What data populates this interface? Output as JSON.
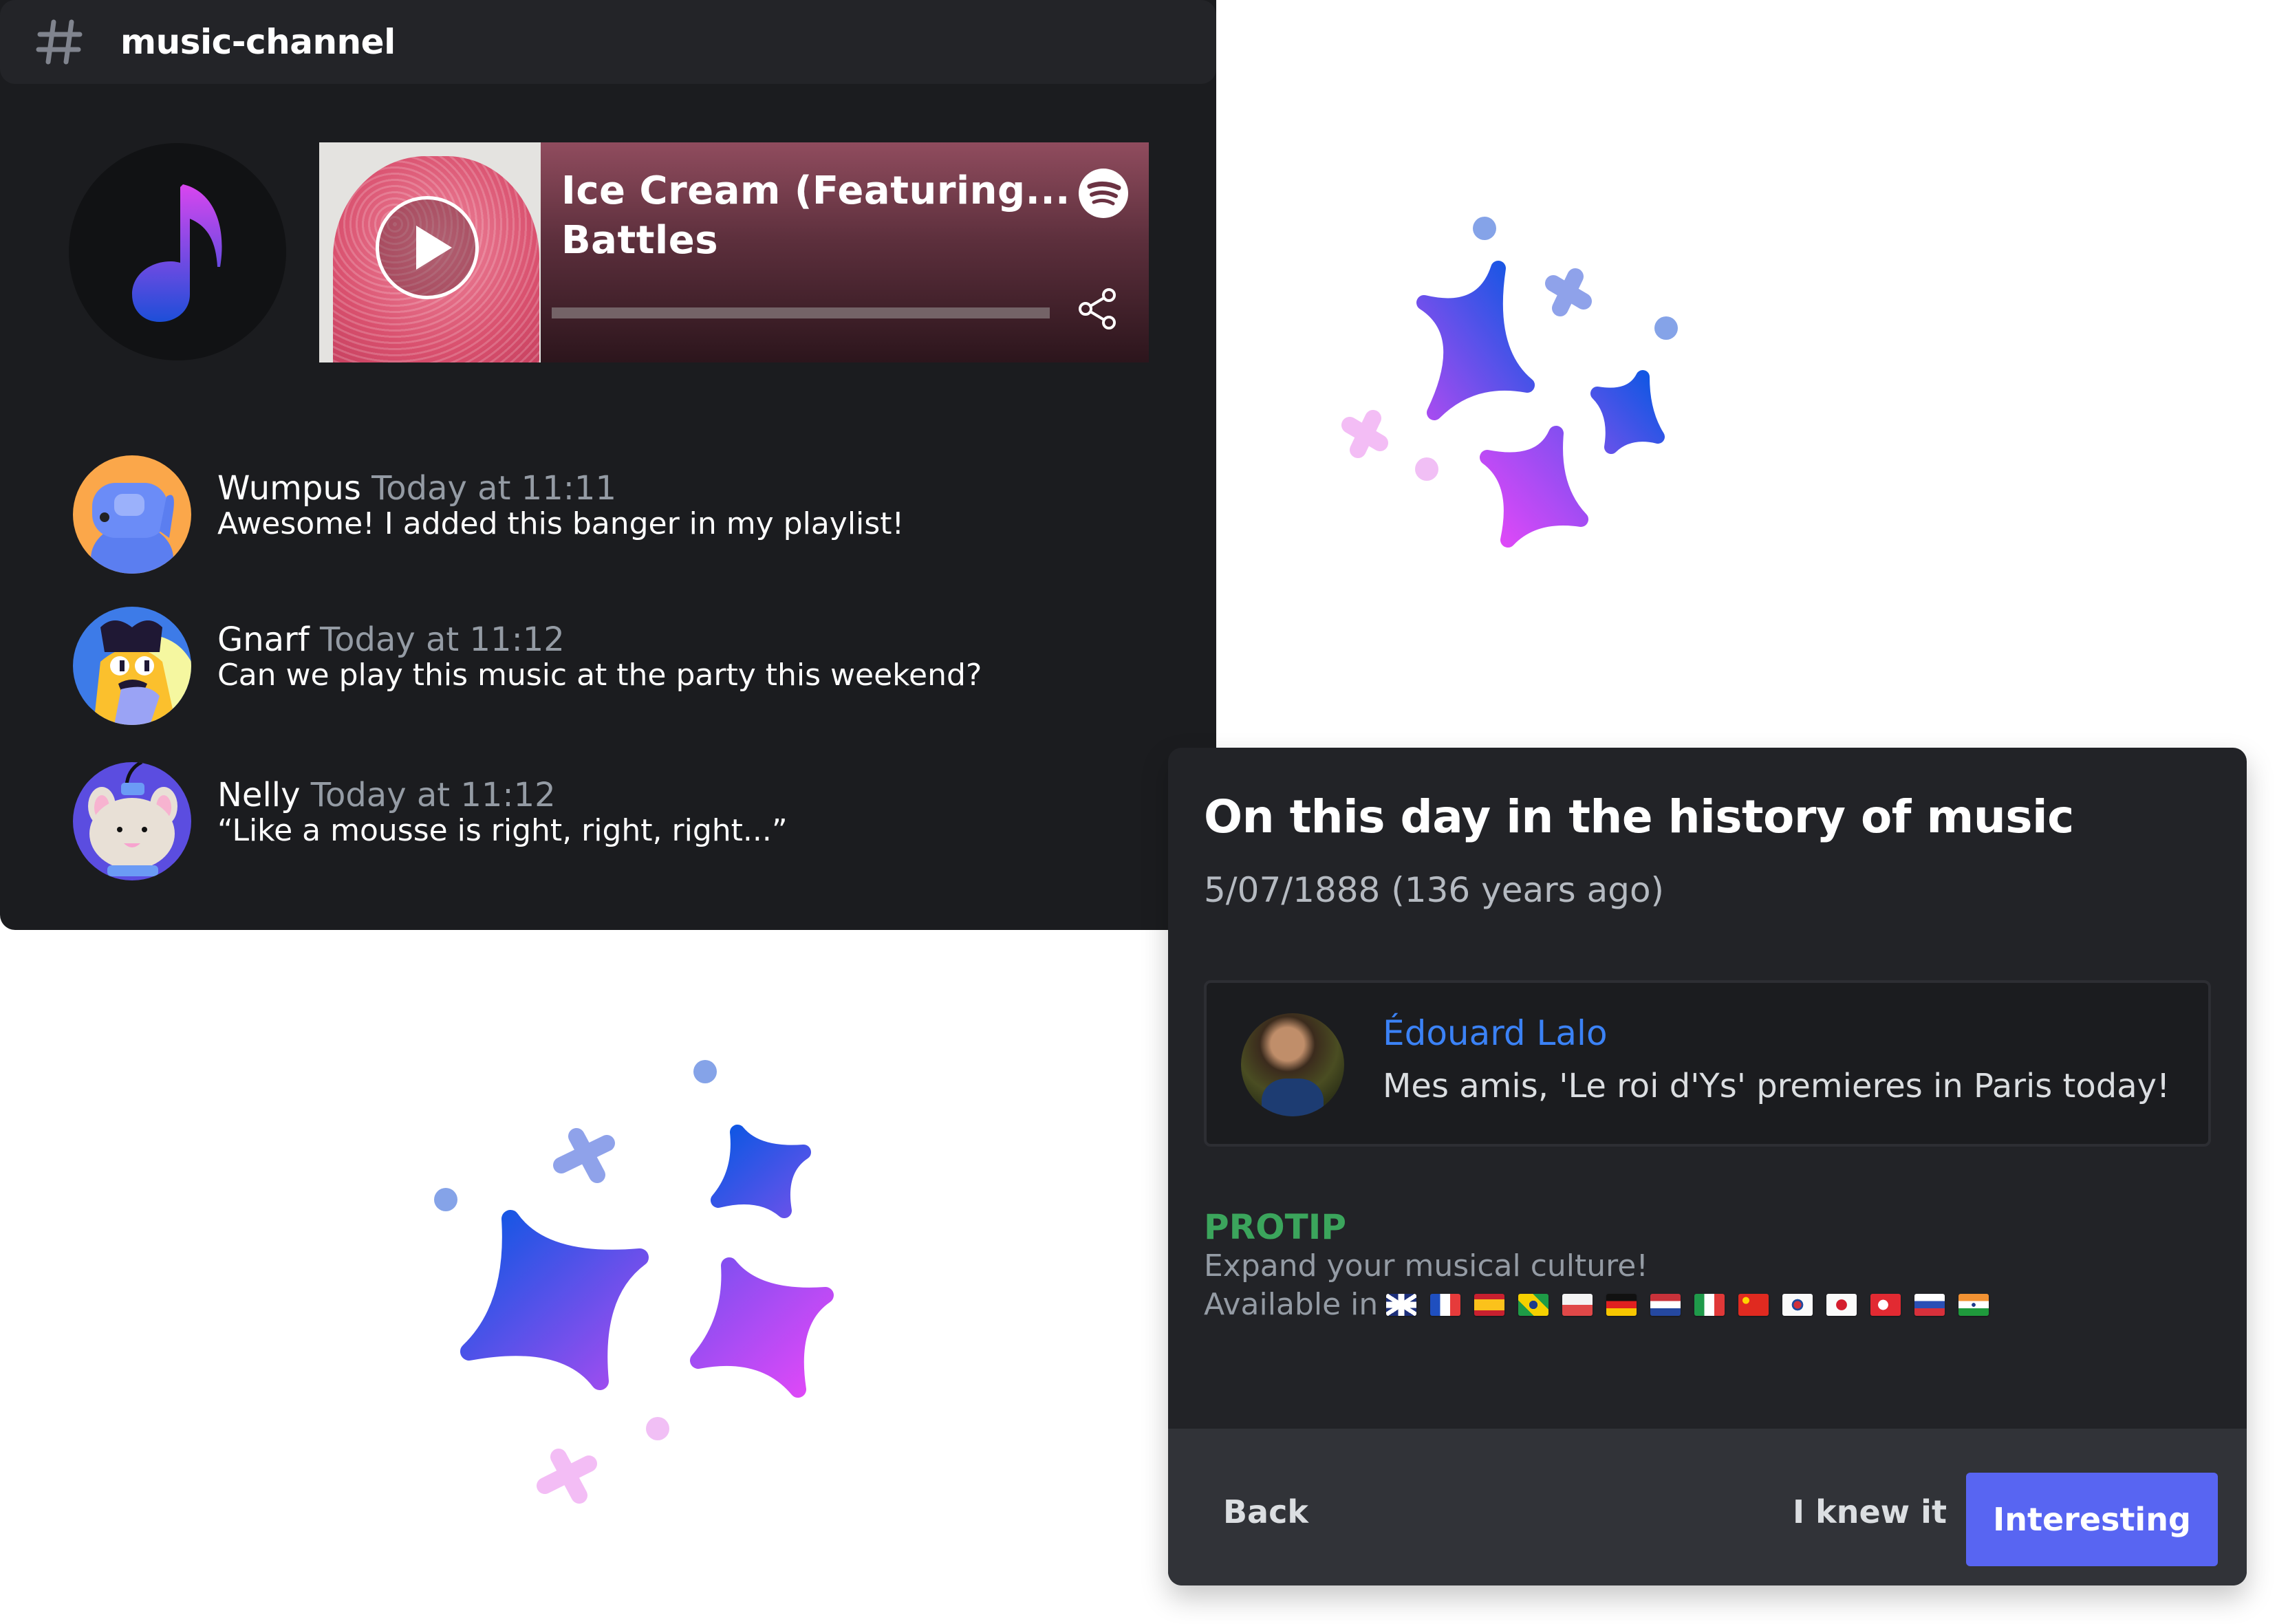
{
  "chat": {
    "channel_icon": "hash-icon",
    "channel_name": "music-channel",
    "embed": {
      "icon": "music-note-icon",
      "track_title": "Ice Cream (Featuring...",
      "artist": "Battles",
      "provider_icon": "spotify-icon",
      "share_icon": "share-icon",
      "play_icon": "play-icon",
      "progress_percent": 0
    },
    "messages": [
      {
        "author": "Wumpus",
        "timestamp": "Today at 11:11",
        "text": "Awesome! I added this banger in my playlist!"
      },
      {
        "author": "Gnarf",
        "timestamp": "Today at 11:12",
        "text": "Can we play this music at the party this weekend?"
      },
      {
        "author": "Nelly",
        "timestamp": "Today at 11:12",
        "text": "“Like a mousse is right, right, right...”"
      }
    ]
  },
  "card": {
    "title": "On this day in the history of music",
    "date": "5/07/1888 (136 years ago)",
    "quote": {
      "author": "Édouard Lalo",
      "text": "Mes amis, 'Le roi d'Ys' premieres in Paris today!"
    },
    "protip": {
      "label": "PROTIP",
      "text": "Expand your musical culture!",
      "available_label": "Available in",
      "languages": [
        "uk",
        "fr",
        "es",
        "br",
        "pl",
        "de",
        "nl",
        "it",
        "cn",
        "kr",
        "jp",
        "tr",
        "ru",
        "in"
      ]
    },
    "buttons": {
      "back": "Back",
      "knew": "I knew it",
      "primary": "Interesting"
    }
  },
  "colors": {
    "accent": "#5865f2",
    "protip": "#3ba55c",
    "link": "#3b82f6",
    "muted": "#949ba4"
  }
}
